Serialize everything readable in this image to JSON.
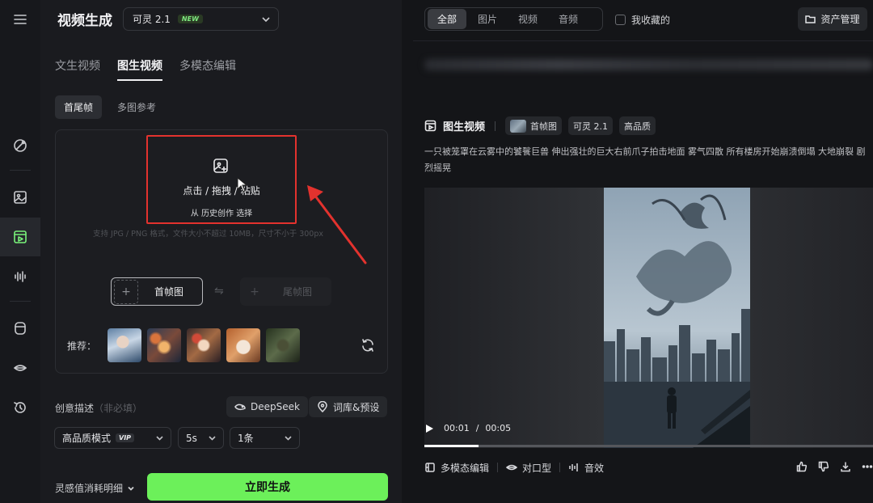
{
  "header": {
    "title": "视频生成",
    "model": {
      "name": "可灵 2.1",
      "badge": "NEW"
    }
  },
  "sidebar": {
    "icons": [
      "menu-icon",
      "magic-icon",
      "image-icon",
      "video-icon",
      "audio-icon",
      "avatar-icon",
      "lips-icon",
      "history-icon"
    ],
    "active": "video-icon"
  },
  "tabs": [
    "文生视频",
    "图生视频",
    "多模态编辑"
  ],
  "active_tab": "图生视频",
  "subtabs": [
    "首尾帧",
    "多图参考"
  ],
  "active_subtab": "首尾帧",
  "upload": {
    "main_text": "点击 / 拖拽 / 粘贴",
    "sub_prefix": "从",
    "sub_link": "历史创作",
    "sub_suffix": "选择",
    "hint": "支持 JPG / PNG 格式，文件大小不超过 10MB，尺寸不小于 300px"
  },
  "frames": {
    "first": "首帧图",
    "last": "尾帧图"
  },
  "recommend": {
    "label": "推荐："
  },
  "description": {
    "label": "创意描述",
    "optional": "（非必填）"
  },
  "tools": {
    "deepseek": "DeepSeek",
    "library": "词库&预设"
  },
  "options": {
    "quality": "高品质模式",
    "vip": "VIP",
    "duration": "5s",
    "count": "1条"
  },
  "footer": {
    "cost": "灵感值消耗明细",
    "generate": "立即生成"
  },
  "right": {
    "filters": [
      "全部",
      "图片",
      "视频",
      "音频"
    ],
    "active_filter": "全部",
    "favorites": "我收藏的",
    "asset_manager": "资产管理",
    "card": {
      "title": "图生视频",
      "tags": [
        "首帧图",
        "可灵 2.1",
        "高品质"
      ],
      "prompt": "一只被笼罩在云雾中的饕餮巨兽 伸出强壮的巨大右前爪子拍击地面 雾气四散 所有楼房开始崩溃倒塌 大地崩裂 剧烈摇晃",
      "time_current": "00:01",
      "time_total": "00:05",
      "time_sep": "/",
      "progress": 0.12,
      "actions": [
        "多模态编辑",
        "对口型",
        "音效"
      ]
    }
  },
  "colors": {
    "accent": "#6cf05a",
    "highlight": "#e3322e"
  }
}
